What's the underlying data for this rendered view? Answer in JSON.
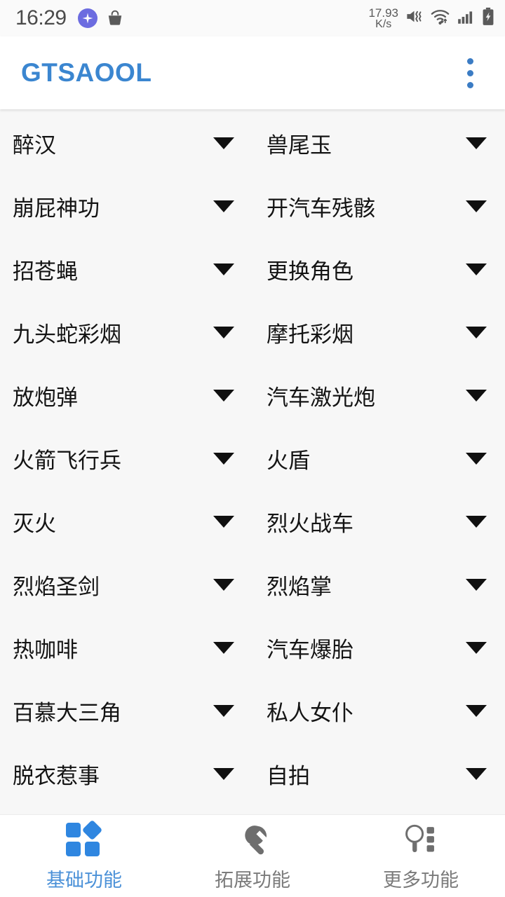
{
  "status_bar": {
    "time": "16:29",
    "net_speed_value": "17.93",
    "net_speed_unit": "K/s",
    "icons": [
      "sparkle-badge-icon",
      "basket-icon",
      "mute-vibrate-icon",
      "wifi-icon",
      "signal-bars-icon",
      "battery-charging-icon"
    ]
  },
  "app_bar": {
    "title": "GTSAOOL",
    "overflow_menu": "overflow-menu-icon",
    "title_color": "#3b86d0"
  },
  "list": {
    "rows": [
      {
        "left": "醉汉",
        "right": "兽尾玉"
      },
      {
        "left": "崩屁神功",
        "right": "开汽车残骸"
      },
      {
        "left": "招苍蝇",
        "right": "更换角色"
      },
      {
        "left": "九头蛇彩烟",
        "right": "摩托彩烟"
      },
      {
        "left": "放炮弹",
        "right": "汽车激光炮"
      },
      {
        "left": "火箭飞行兵",
        "right": "火盾"
      },
      {
        "left": "灭火",
        "right": "烈火战车"
      },
      {
        "left": "烈焰圣剑",
        "right": "烈焰掌"
      },
      {
        "left": "热咖啡",
        "right": "汽车爆胎"
      },
      {
        "left": "百慕大三角",
        "right": "私人女仆"
      },
      {
        "left": "脱衣惹事",
        "right": "自拍"
      }
    ]
  },
  "bottom_nav": {
    "active_index": 0,
    "active_color": "#4b91d8",
    "inactive_color": "#7b7b7b",
    "items": [
      {
        "label": "基础功能",
        "icon": "grid-blocks-icon"
      },
      {
        "label": "拓展功能",
        "icon": "wrench-icon"
      },
      {
        "label": "更多功能",
        "icon": "magnifier-list-icon"
      }
    ]
  }
}
